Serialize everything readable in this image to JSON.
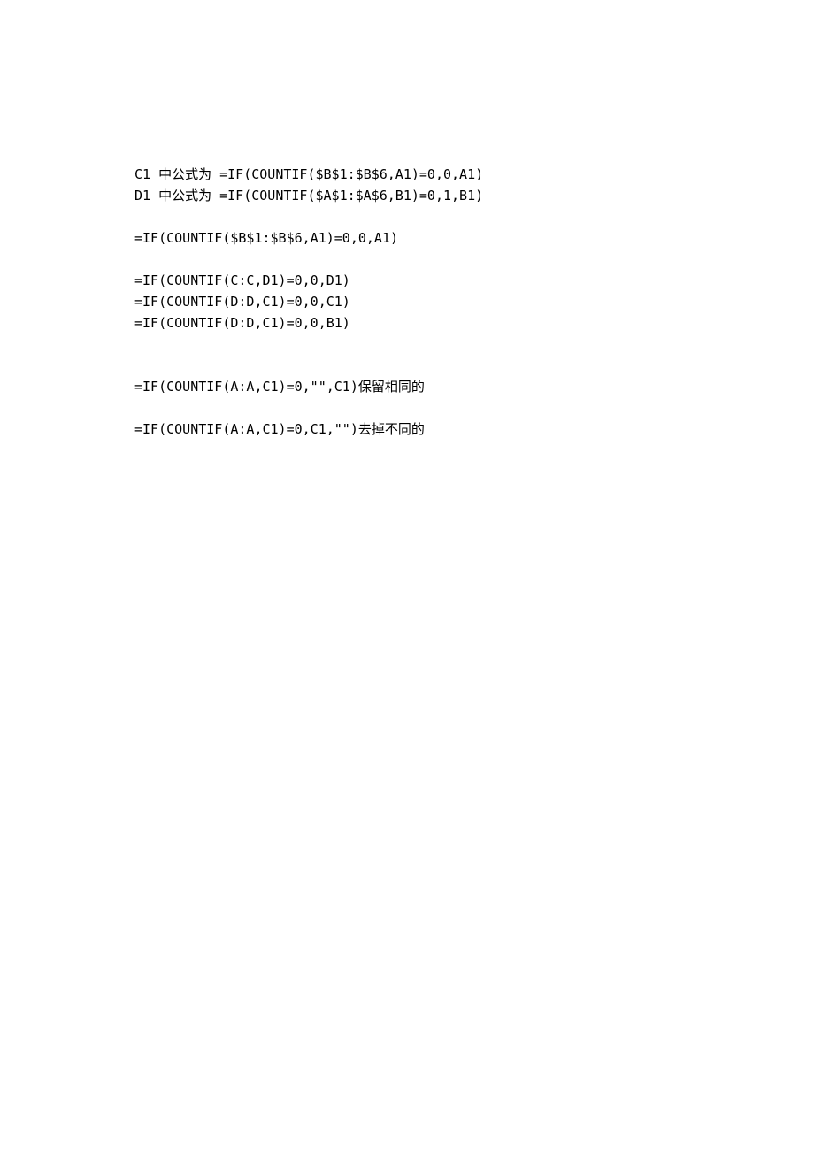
{
  "lines": {
    "l1": "C1 中公式为 =IF(COUNTIF($B$1:$B$6,A1)=0,0,A1)",
    "l2": "D1 中公式为 =IF(COUNTIF($A$1:$A$6,B1)=0,1,B1)",
    "l3": "=IF(COUNTIF($B$1:$B$6,A1)=0,0,A1)",
    "l4": "=IF(COUNTIF(C:C,D1)=0,0,D1)",
    "l5": "=IF(COUNTIF(D:D,C1)=0,0,C1)",
    "l6": "=IF(COUNTIF(D:D,C1)=0,0,B1)",
    "l7": "=IF(COUNTIF(A:A,C1)=0,\"\",C1)保留相同的",
    "l8": "=IF(COUNTIF(A:A,C1)=0,C1,\"\")去掉不同的"
  }
}
